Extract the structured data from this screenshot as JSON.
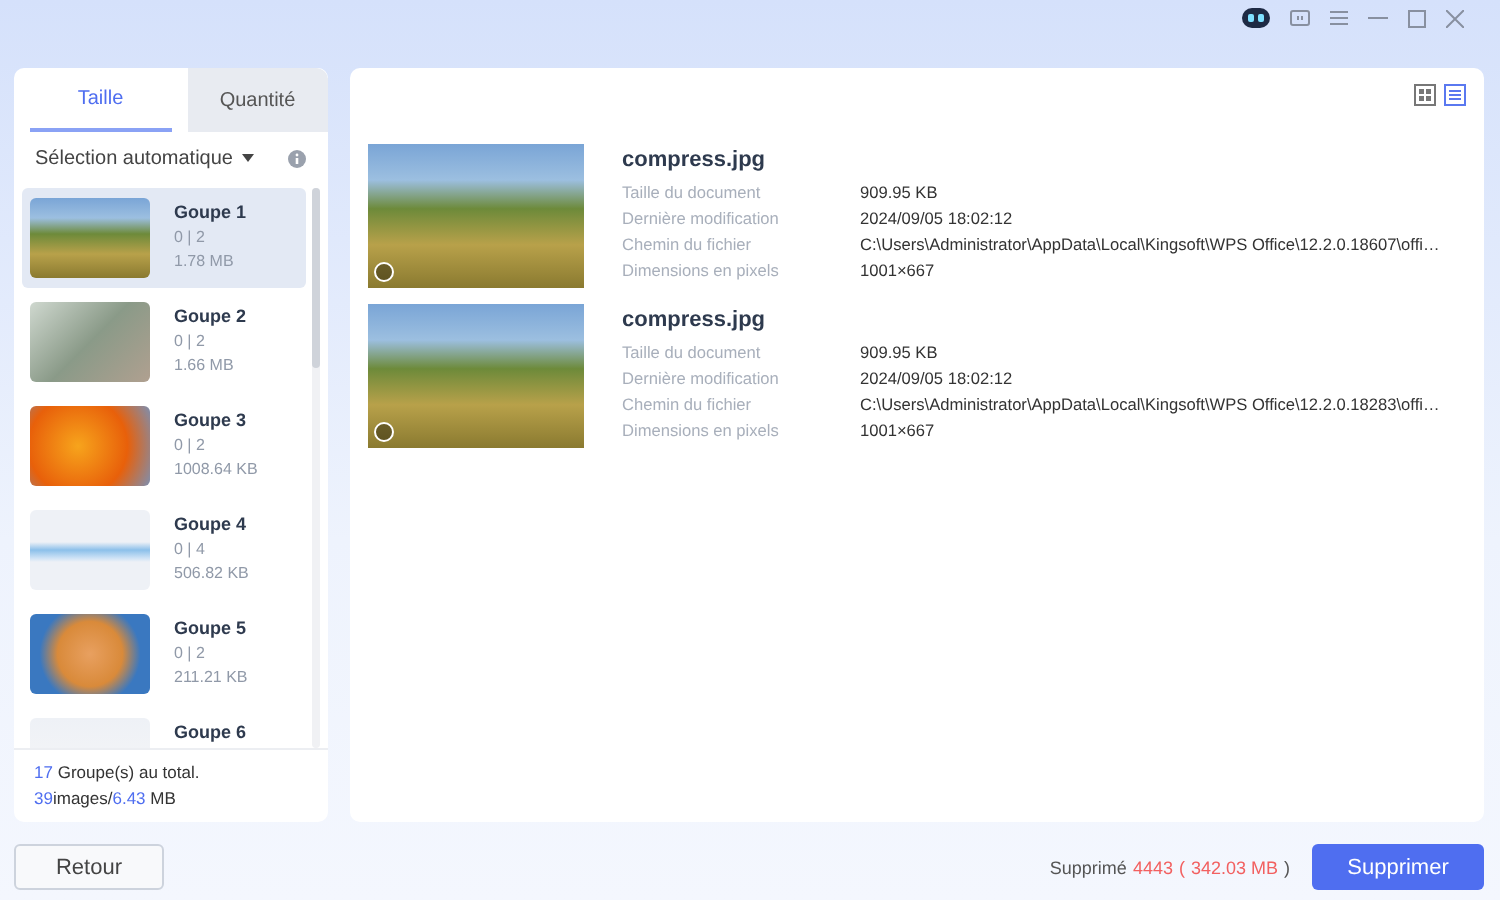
{
  "tabs": [
    {
      "label": "Taille",
      "selected": true
    },
    {
      "label": "Quantité",
      "selected": false
    }
  ],
  "auto_select": {
    "label": "Sélection automatique"
  },
  "groups": [
    {
      "name": "Goupe 1",
      "count": "0 | 2",
      "size": "1.78 MB",
      "selected": true
    },
    {
      "name": "Goupe 2",
      "count": "0 | 2",
      "size": "1.66 MB",
      "selected": false
    },
    {
      "name": "Goupe 3",
      "count": "0 | 2",
      "size": "1008.64 KB",
      "selected": false
    },
    {
      "name": "Goupe 4",
      "count": "0 | 4",
      "size": "506.82 KB",
      "selected": false
    },
    {
      "name": "Goupe 5",
      "count": "0 | 2",
      "size": "211.21 KB",
      "selected": false
    },
    {
      "name": "Goupe 6",
      "selected": false
    }
  ],
  "summary": {
    "group_count": "17",
    "group_text": "Groupe(s) au total.",
    "image_count": "39",
    "image_text": "images/",
    "total_size": "6.43",
    "size_unit": "MB"
  },
  "view_modes": [
    {
      "kind": "grid",
      "selected": false
    },
    {
      "kind": "list",
      "selected": true
    }
  ],
  "files": [
    {
      "name": "compress.jpg",
      "checked": false,
      "details": [
        {
          "label": "Taille du document",
          "value": "909.95 KB"
        },
        {
          "label": "Dernière modification",
          "value": "2024/09/05 18:02:12"
        },
        {
          "label": "Chemin du fichier",
          "value": "C:\\Users\\Administrator\\AppData\\Local\\Kingsoft\\WPS Office\\12.2.0.18607\\offi…"
        },
        {
          "label": "Dimensions en pixels",
          "value": "1001×667"
        }
      ]
    },
    {
      "name": "compress.jpg",
      "checked": false,
      "details": [
        {
          "label": "Taille du document",
          "value": "909.95 KB"
        },
        {
          "label": "Dernière modification",
          "value": "2024/09/05 18:02:12"
        },
        {
          "label": "Chemin du fichier",
          "value": "C:\\Users\\Administrator\\AppData\\Local\\Kingsoft\\WPS Office\\12.2.0.18283\\offi…"
        },
        {
          "label": "Dimensions en pixels",
          "value": "1001×667"
        }
      ]
    }
  ],
  "footer": {
    "back_button": "Retour",
    "deleted_label": "Supprimé",
    "deleted_count": "4443",
    "deleted_open": "(",
    "deleted_size": "342.03 MB",
    "deleted_close": ")",
    "delete_button": "Supprimer"
  }
}
